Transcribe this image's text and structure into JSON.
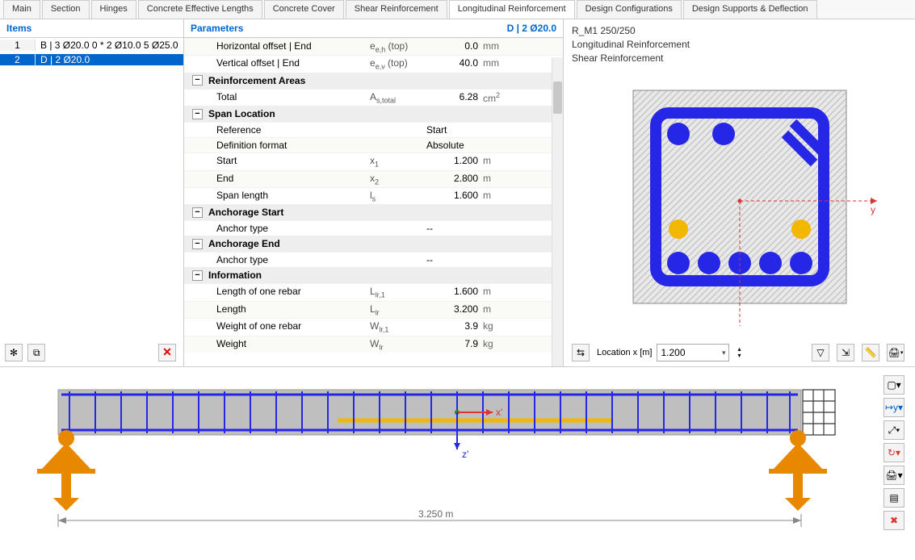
{
  "tabs": [
    "Main",
    "Section",
    "Hinges",
    "Concrete Effective Lengths",
    "Concrete Cover",
    "Shear Reinforcement",
    "Longitudinal Reinforcement",
    "Design Configurations",
    "Design Supports & Deflection"
  ],
  "tabs_active": 6,
  "items": {
    "header": "Items",
    "rows": [
      {
        "n": "1",
        "label": "B | 3 Ø20.0 0 * 2 Ø10.0 5 Ø25.0"
      },
      {
        "n": "2",
        "label": "D | 2 Ø20.0"
      }
    ],
    "selected": 1
  },
  "params_header": {
    "left": "Parameters",
    "right": "D | 2 Ø20.0"
  },
  "params": [
    {
      "row": true,
      "label": "Horizontal offset | End",
      "sym": "e<sub>e,h</sub> (top)",
      "val": "0.0",
      "unit": "mm"
    },
    {
      "row": true,
      "label": "Vertical offset | End",
      "sym": "e<sub>e,v</sub> (top)",
      "val": "40.0",
      "unit": "mm"
    },
    {
      "group": "Reinforcement Areas"
    },
    {
      "row": true,
      "label": "Total",
      "sym": "A<sub>s,total</sub>",
      "val": "6.28",
      "unit": "cm<sup>2</sup>"
    },
    {
      "group": "Span Location"
    },
    {
      "row": true,
      "label": "Reference",
      "sym": "",
      "val": "Start",
      "unit": "",
      "lalign": true
    },
    {
      "row": true,
      "label": "Definition format",
      "sym": "",
      "val": "Absolute",
      "unit": "",
      "lalign": true
    },
    {
      "row": true,
      "label": "Start",
      "sym": "x<sub>1</sub>",
      "val": "1.200",
      "unit": "m"
    },
    {
      "row": true,
      "label": "End",
      "sym": "x<sub>2</sub>",
      "val": "2.800",
      "unit": "m"
    },
    {
      "row": true,
      "label": "Span length",
      "sym": "l<sub>s</sub>",
      "val": "1.600",
      "unit": "m"
    },
    {
      "group": "Anchorage Start"
    },
    {
      "row": true,
      "label": "Anchor type",
      "sym": "",
      "val": "--",
      "unit": "",
      "lalign": true
    },
    {
      "group": "Anchorage End"
    },
    {
      "row": true,
      "label": "Anchor type",
      "sym": "",
      "val": "--",
      "unit": "",
      "lalign": true
    },
    {
      "group": "Information"
    },
    {
      "row": true,
      "label": "Length of one rebar",
      "sym": "L<sub>lr,1</sub>",
      "val": "1.600",
      "unit": "m"
    },
    {
      "row": true,
      "label": "Length",
      "sym": "L<sub>lr</sub>",
      "val": "3.200",
      "unit": "m"
    },
    {
      "row": true,
      "label": "Weight of one rebar",
      "sym": "W<sub>lr,1</sub>",
      "val": "3.9",
      "unit": "kg"
    },
    {
      "row": true,
      "label": "Weight",
      "sym": "W<sub>lr</sub>",
      "val": "7.9",
      "unit": "kg"
    }
  ],
  "info": {
    "lines": [
      "R_M1 250/250",
      "Longitudinal Reinforcement",
      "Shear Reinforcement"
    ],
    "y_label": "y",
    "loc_label": "Location x [m]",
    "loc_value": "1.200"
  },
  "beam": {
    "length_label": "3.250 m",
    "axis_x": "x'",
    "axis_z": "z'"
  }
}
